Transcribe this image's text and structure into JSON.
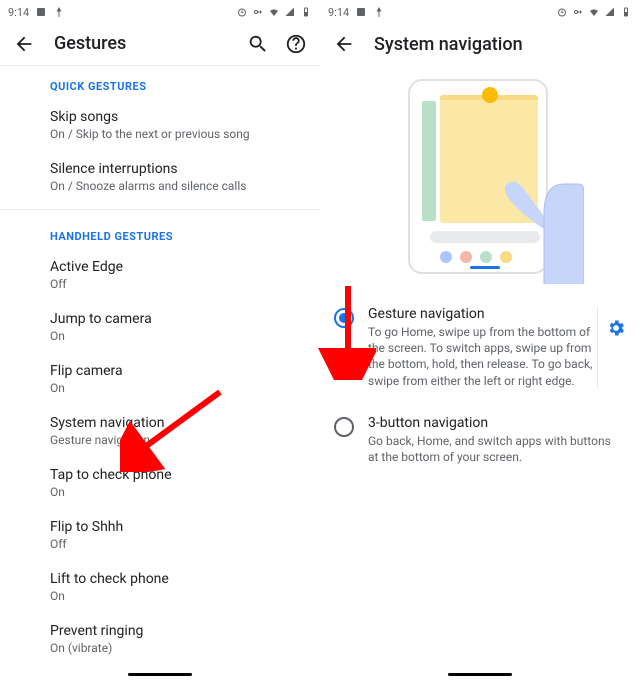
{
  "status": {
    "time": "9:14"
  },
  "left": {
    "title": "Gestures",
    "sectionA": "QUICK GESTURES",
    "sectionB": "HANDHELD GESTURES",
    "items": {
      "skip": {
        "title": "Skip songs",
        "sub": "On / Skip to the next or previous song"
      },
      "silence": {
        "title": "Silence interruptions",
        "sub": "On / Snooze alarms and silence calls"
      },
      "active": {
        "title": "Active Edge",
        "sub": "Off"
      },
      "jump": {
        "title": "Jump to camera",
        "sub": "On"
      },
      "flipcam": {
        "title": "Flip camera",
        "sub": "On"
      },
      "sysnav": {
        "title": "System navigation",
        "sub": "Gesture navigation"
      },
      "tap": {
        "title": "Tap to check phone",
        "sub": "On"
      },
      "shhh": {
        "title": "Flip to Shhh",
        "sub": "Off"
      },
      "lift": {
        "title": "Lift to check phone",
        "sub": "On"
      },
      "prevent": {
        "title": "Prevent ringing",
        "sub": "On (vibrate)"
      }
    }
  },
  "right": {
    "title": "System navigation",
    "options": {
      "gesture": {
        "title": "Gesture navigation",
        "desc": "To go Home, swipe up from the bottom of the screen. To switch apps, swipe up from the bottom, hold, then release. To go back, swipe from either the left or right edge."
      },
      "threebtn": {
        "title": "3-button navigation",
        "desc": "Go back, Home, and switch apps with buttons at the bottom of your screen."
      }
    }
  }
}
